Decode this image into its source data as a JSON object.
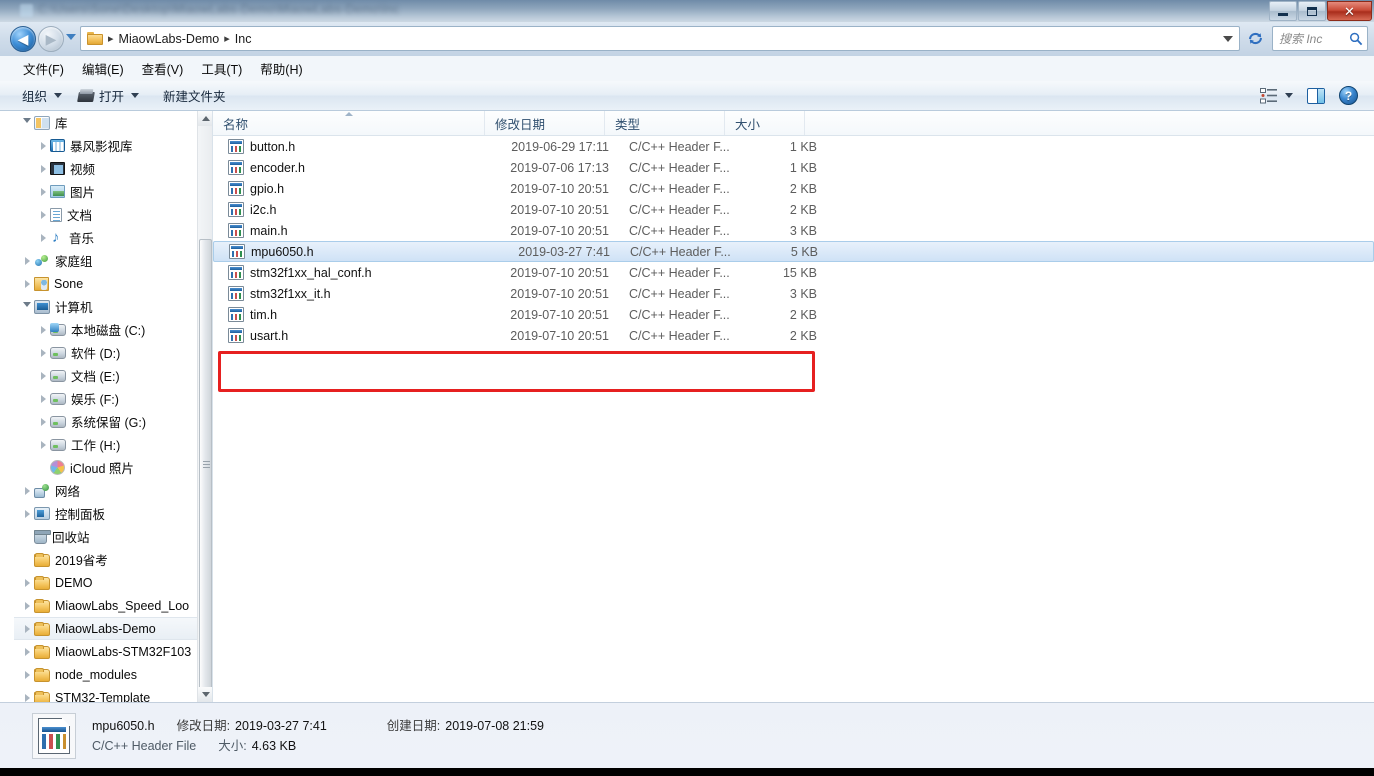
{
  "window": {
    "titlebar_blur_text": "C:\\Users\\Sone\\Desktop\\MiaowLabs-Demo\\MiaowLabs-Demo\\Inc",
    "buttons": {
      "minimize": "—",
      "maximize": "❐",
      "close": "✕"
    }
  },
  "address": {
    "back_tooltip": "后退",
    "forward_tooltip": "前进",
    "crumbs": [
      "MiaowLabs-Demo",
      "Inc"
    ],
    "separator": "▸",
    "refresh_label": "刷新"
  },
  "search": {
    "placeholder": "搜索 Inc"
  },
  "menubar": {
    "items": [
      {
        "label": "文件(F)",
        "name": "menu-file"
      },
      {
        "label": "编辑(E)",
        "name": "menu-edit"
      },
      {
        "label": "查看(V)",
        "name": "menu-view"
      },
      {
        "label": "工具(T)",
        "name": "menu-tools"
      },
      {
        "label": "帮助(H)",
        "name": "menu-help"
      }
    ]
  },
  "toolbar": {
    "organize": "组织",
    "open": "打开",
    "new_folder": "新建文件夹",
    "view_tooltip": "更改您的视图",
    "preview_tooltip": "显示预览窗格",
    "help_tooltip": "获取帮助",
    "help_glyph": "?"
  },
  "sidebar": {
    "items": [
      {
        "label": "库",
        "icon": "library-icon",
        "depth": 0,
        "twisty": "open",
        "selected": false
      },
      {
        "label": "暴风影视库",
        "icon": "video-lib-icon",
        "depth": 1,
        "twisty": "closed",
        "selected": false
      },
      {
        "label": "视频",
        "icon": "film-icon",
        "depth": 1,
        "twisty": "closed",
        "selected": false
      },
      {
        "label": "图片",
        "icon": "picture-icon",
        "depth": 1,
        "twisty": "closed",
        "selected": false
      },
      {
        "label": "文档",
        "icon": "document-icon",
        "depth": 1,
        "twisty": "closed",
        "selected": false
      },
      {
        "label": "音乐",
        "icon": "music-icon",
        "depth": 1,
        "twisty": "closed",
        "selected": false
      },
      {
        "label": "家庭组",
        "icon": "homegroup-icon",
        "depth": 0,
        "twisty": "closed",
        "selected": false
      },
      {
        "label": "Sone",
        "icon": "user-icon",
        "depth": 0,
        "twisty": "closed",
        "selected": false
      },
      {
        "label": "计算机",
        "icon": "computer-icon",
        "depth": 0,
        "twisty": "open",
        "selected": false
      },
      {
        "label": "本地磁盘 (C:)",
        "icon": "system-drive-icon",
        "depth": 1,
        "twisty": "closed",
        "selected": false
      },
      {
        "label": "软件 (D:)",
        "icon": "drive-icon",
        "depth": 1,
        "twisty": "closed",
        "selected": false
      },
      {
        "label": "文档 (E:)",
        "icon": "drive-icon",
        "depth": 1,
        "twisty": "closed",
        "selected": false
      },
      {
        "label": "娱乐 (F:)",
        "icon": "drive-icon",
        "depth": 1,
        "twisty": "closed",
        "selected": false
      },
      {
        "label": "系统保留 (G:)",
        "icon": "drive-icon",
        "depth": 1,
        "twisty": "closed",
        "selected": false
      },
      {
        "label": "工作 (H:)",
        "icon": "drive-icon",
        "depth": 1,
        "twisty": "closed",
        "selected": false
      },
      {
        "label": "iCloud 照片",
        "icon": "icloud-icon",
        "depth": 1,
        "twisty": "none",
        "selected": false
      },
      {
        "label": "网络",
        "icon": "network-icon",
        "depth": 0,
        "twisty": "closed",
        "selected": false
      },
      {
        "label": "控制面板",
        "icon": "control-panel-icon",
        "depth": 0,
        "twisty": "closed",
        "selected": false
      },
      {
        "label": "回收站",
        "icon": "recycle-bin-icon",
        "depth": 0,
        "twisty": "none",
        "selected": false
      },
      {
        "label": "2019省考",
        "icon": "folder-icon",
        "depth": 0,
        "twisty": "none",
        "selected": false
      },
      {
        "label": "DEMO",
        "icon": "folder-icon",
        "depth": 0,
        "twisty": "closed",
        "selected": false
      },
      {
        "label": "MiaowLabs_Speed_Loo",
        "icon": "folder-icon",
        "depth": 0,
        "twisty": "closed",
        "selected": false
      },
      {
        "label": "MiaowLabs-Demo",
        "icon": "folder-icon",
        "depth": 0,
        "twisty": "closed",
        "selected": true
      },
      {
        "label": "MiaowLabs-STM32F103",
        "icon": "folder-icon",
        "depth": 0,
        "twisty": "closed",
        "selected": false
      },
      {
        "label": "node_modules",
        "icon": "folder-icon",
        "depth": 0,
        "twisty": "closed",
        "selected": false
      },
      {
        "label": "STM32-Template",
        "icon": "folder-icon",
        "depth": 0,
        "twisty": "closed",
        "selected": false
      }
    ]
  },
  "filelist": {
    "columns": [
      {
        "label": "名称",
        "name": "column-name",
        "sorted": true
      },
      {
        "label": "修改日期",
        "name": "column-date",
        "sorted": false
      },
      {
        "label": "类型",
        "name": "column-type",
        "sorted": false
      },
      {
        "label": "大小",
        "name": "column-size",
        "sorted": false
      }
    ],
    "rows": [
      {
        "name": "button.h",
        "date": "2019-06-29 17:11",
        "type": "C/C++ Header F...",
        "size": "1 KB",
        "selected": false
      },
      {
        "name": "encoder.h",
        "date": "2019-07-06 17:13",
        "type": "C/C++ Header F...",
        "size": "1 KB",
        "selected": false
      },
      {
        "name": "gpio.h",
        "date": "2019-07-10 20:51",
        "type": "C/C++ Header F...",
        "size": "2 KB",
        "selected": false
      },
      {
        "name": "i2c.h",
        "date": "2019-07-10 20:51",
        "type": "C/C++ Header F...",
        "size": "2 KB",
        "selected": false
      },
      {
        "name": "main.h",
        "date": "2019-07-10 20:51",
        "type": "C/C++ Header F...",
        "size": "3 KB",
        "selected": false
      },
      {
        "name": "mpu6050.h",
        "date": "2019-03-27 7:41",
        "type": "C/C++ Header F...",
        "size": "5 KB",
        "selected": true
      },
      {
        "name": "stm32f1xx_hal_conf.h",
        "date": "2019-07-10 20:51",
        "type": "C/C++ Header F...",
        "size": "15 KB",
        "selected": false
      },
      {
        "name": "stm32f1xx_it.h",
        "date": "2019-07-10 20:51",
        "type": "C/C++ Header F...",
        "size": "3 KB",
        "selected": false
      },
      {
        "name": "tim.h",
        "date": "2019-07-10 20:51",
        "type": "C/C++ Header F...",
        "size": "2 KB",
        "selected": false
      },
      {
        "name": "usart.h",
        "date": "2019-07-10 20:51",
        "type": "C/C++ Header F...",
        "size": "2 KB",
        "selected": false
      }
    ]
  },
  "annotation": {
    "color": "#e62020",
    "target": "mpu6050.h"
  },
  "details": {
    "file_name": "mpu6050.h",
    "file_type": "C/C++ Header File",
    "modified_key": "修改日期:",
    "modified_value": "2019-03-27 7:41",
    "created_key": "创建日期:",
    "created_value": "2019-07-08 21:59",
    "size_key": "大小:",
    "size_value": "4.63 KB"
  }
}
